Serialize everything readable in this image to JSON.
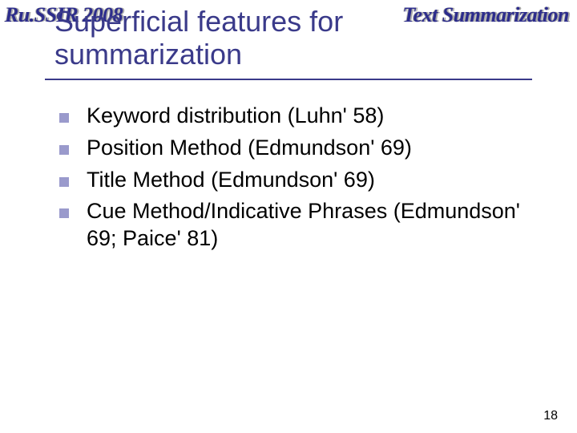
{
  "header": {
    "left": "Ru.SSIR 2008",
    "right": "Text Summarization"
  },
  "title": "Superficial features for summarization",
  "bullets": [
    "Keyword distribution (Luhn' 58)",
    "Position Method (Edmundson' 69)",
    "Title Method (Edmundson' 69)",
    "Cue Method/Indicative Phrases (Edmundson' 69; Paice' 81)"
  ],
  "page_number": "18"
}
